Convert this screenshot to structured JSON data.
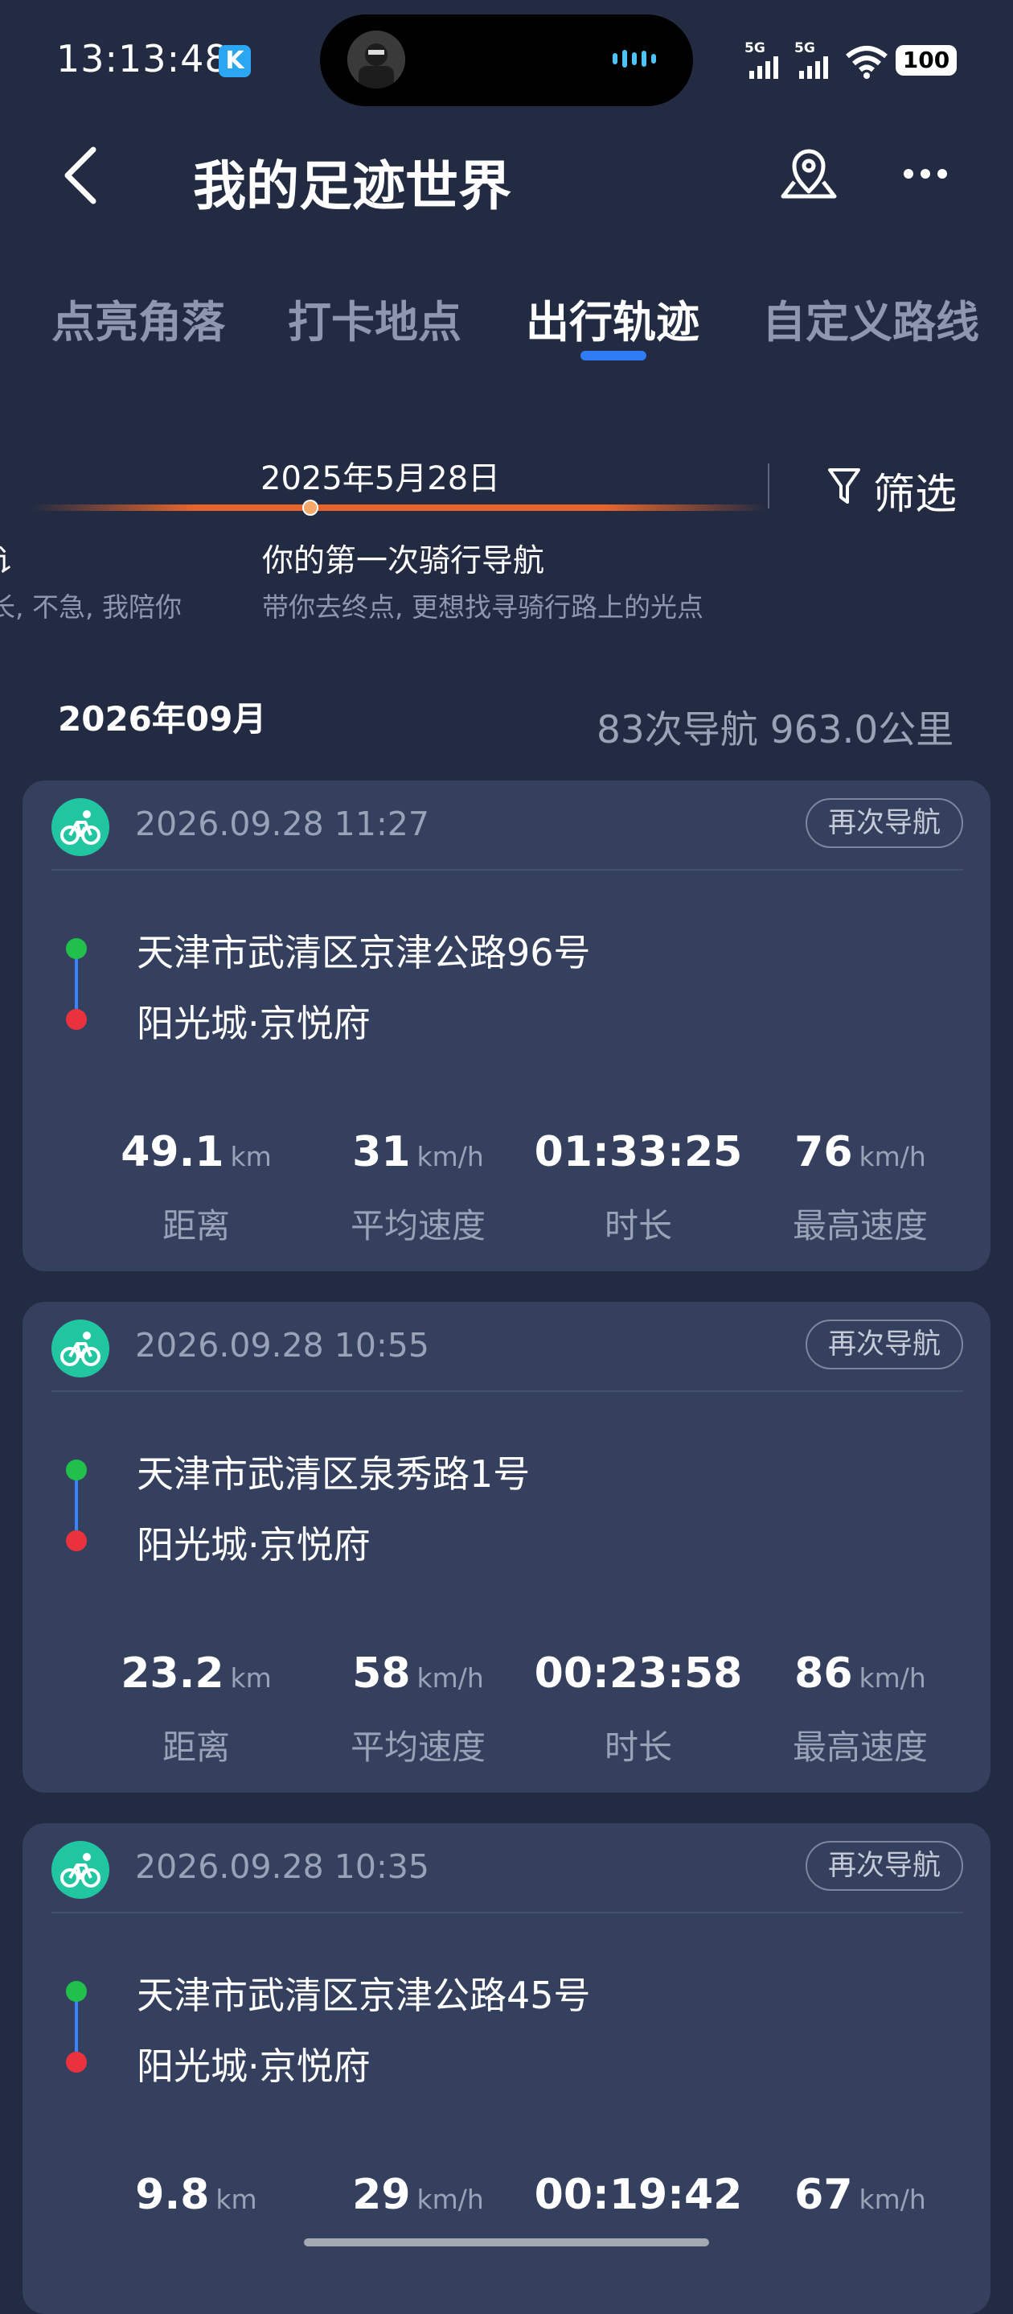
{
  "status_bar": {
    "time": "13:13:48",
    "app_badge": "K",
    "signal1": "5G",
    "signal2": "5G",
    "battery": "100"
  },
  "header": {
    "title": "我的足迹世界"
  },
  "tabs": [
    {
      "label": "点亮角落"
    },
    {
      "label": "打卡地点"
    },
    {
      "label": "出行轨迹",
      "active": true
    },
    {
      "label": "自定义路线"
    }
  ],
  "timeline": {
    "date": "2025年5月28日",
    "filter_label": "筛选",
    "prev_title": "讠",
    "prev_subtitle": "长, 不急, 我陪你",
    "title": "你的第一次骑行导航",
    "subtitle": "带你去终点, 更想找寻骑行路上的光点"
  },
  "month": {
    "label": "2026年09月",
    "summary": "83次导航 963.0公里"
  },
  "labels": {
    "renavigate": "再次导航",
    "distance": "距离",
    "avg_speed": "平均速度",
    "duration": "时长",
    "max_speed": "最高速度",
    "unit_km": "km",
    "unit_kmh": "km/h"
  },
  "trips": [
    {
      "datetime": "2026.09.28 11:27",
      "from": "天津市武清区京津公路96号",
      "to": "阳光城·京悦府",
      "distance": "49.1",
      "avg_speed": "31",
      "duration": "01:33:25",
      "max_speed": "76"
    },
    {
      "datetime": "2026.09.28 10:55",
      "from": "天津市武清区泉秀路1号",
      "to": "阳光城·京悦府",
      "distance": "23.2",
      "avg_speed": "58",
      "duration": "00:23:58",
      "max_speed": "86"
    },
    {
      "datetime": "2026.09.28 10:35",
      "from": "天津市武清区京津公路45号",
      "to": "阳光城·京悦府",
      "distance": "9.8",
      "avg_speed": "29",
      "duration": "00:19:42",
      "max_speed": "67"
    }
  ],
  "colors": {
    "background": "#222b42",
    "card": "#34405d",
    "accent": "#2f7cf6",
    "bike_icon": "#21c6a0",
    "start": "#21c04a",
    "end": "#e9323e"
  }
}
